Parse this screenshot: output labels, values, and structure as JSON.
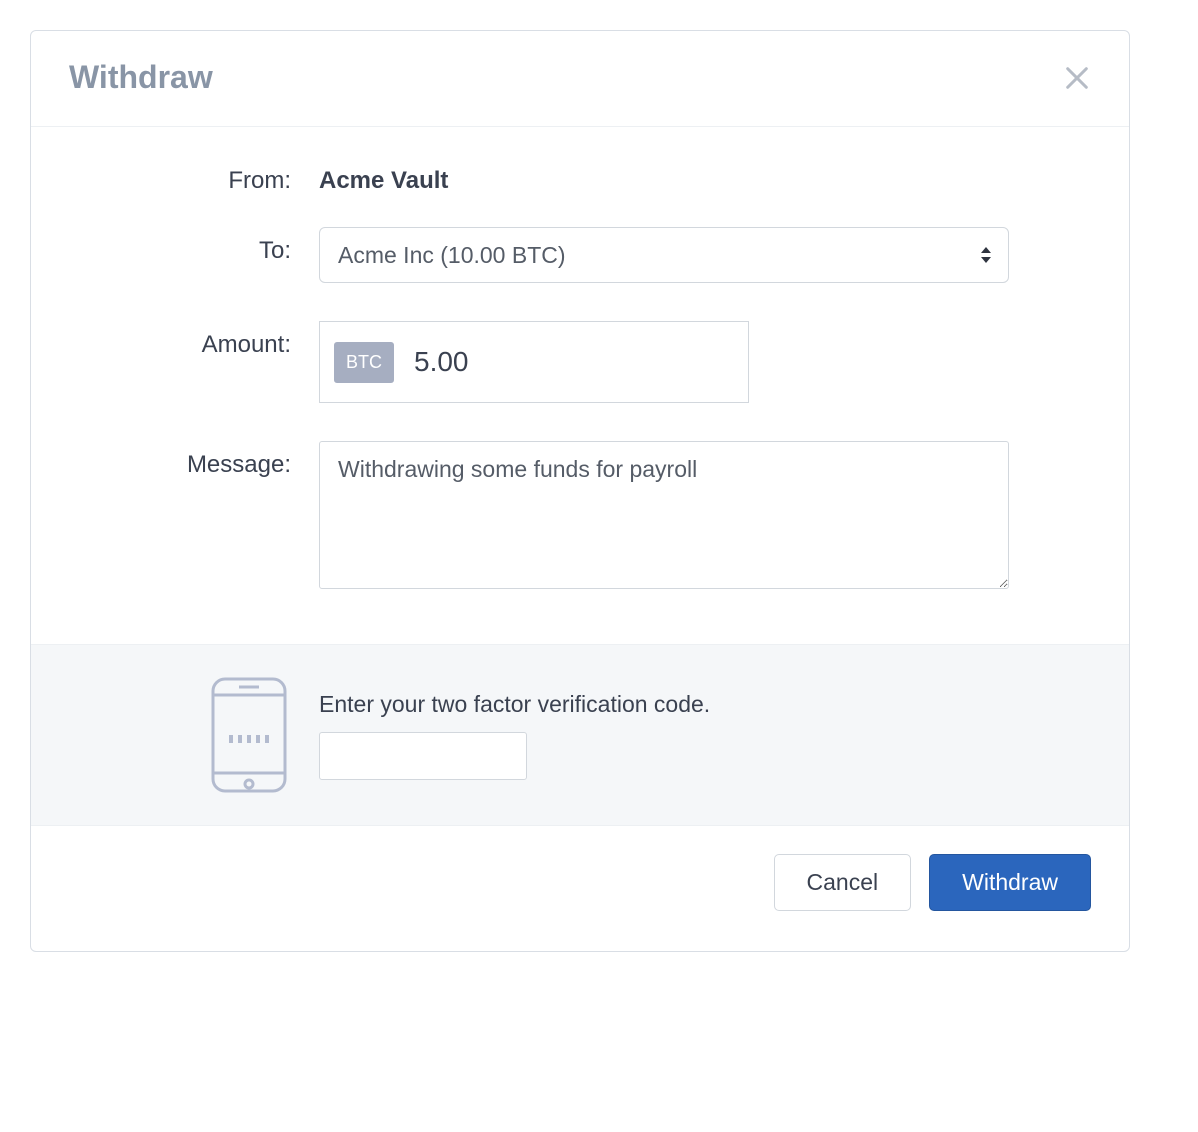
{
  "header": {
    "title": "Withdraw"
  },
  "form": {
    "from_label": "From:",
    "from_value": "Acme Vault",
    "to_label": "To:",
    "to_value": "Acme Inc (10.00 BTC)",
    "amount_label": "Amount:",
    "currency_badge": "BTC",
    "amount_value": "5.00",
    "message_label": "Message:",
    "message_value": "Withdrawing some funds for payroll"
  },
  "twofa": {
    "label": "Enter your two factor verification code.",
    "value": ""
  },
  "footer": {
    "cancel_label": "Cancel",
    "submit_label": "Withdraw"
  }
}
